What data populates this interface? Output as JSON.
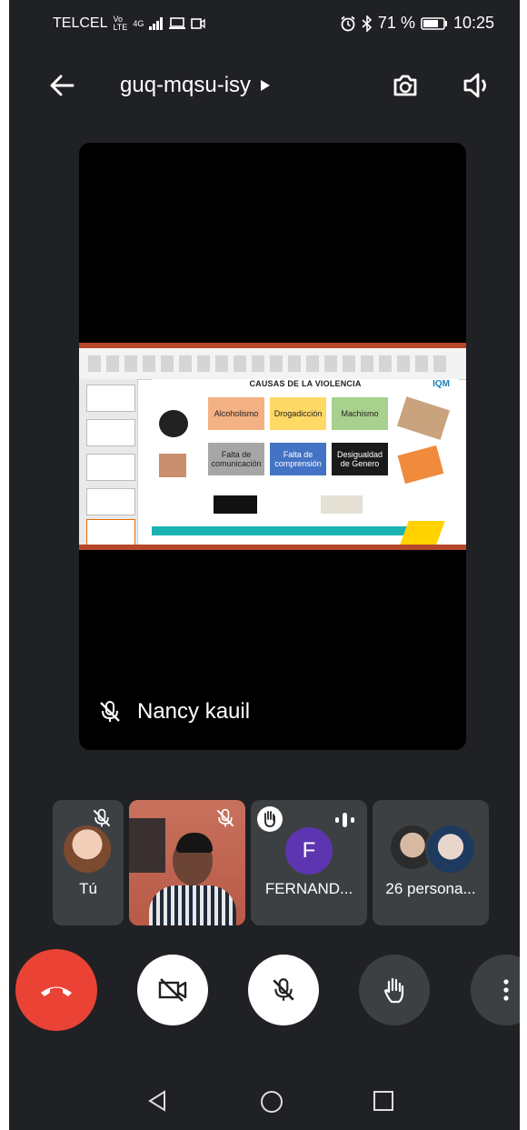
{
  "status_bar": {
    "carrier": "TELCEL",
    "volte": "Vo\nLTE",
    "network": "4G",
    "battery": "71 %",
    "time": "10:25"
  },
  "top_bar": {
    "meeting_code": "guq-mqsu-isy"
  },
  "main_video": {
    "speaker_name": "Nancy kauil",
    "slide": {
      "title": "CAUSAS DE LA VIOLENCIA",
      "logo_text": "IQM",
      "boxes": [
        {
          "label": "Alcoholismo",
          "color": "#f4b183"
        },
        {
          "label": "Drogadicción",
          "color": "#ffd966"
        },
        {
          "label": "Machismo",
          "color": "#a9d18e"
        },
        {
          "label": "Falta de comunicación",
          "color": "#a6a6a6"
        },
        {
          "label": "Falta de comprensión",
          "color": "#4472c4"
        },
        {
          "label": "Desigualdad de Genero",
          "color": "#1a1a1a"
        }
      ]
    }
  },
  "participants": [
    {
      "label": "Tú"
    },
    {
      "label": ""
    },
    {
      "label": "FERNAND...",
      "initial": "F",
      "avatar_color": "#5e35b1"
    },
    {
      "label": "26 persona..."
    }
  ],
  "colors": {
    "background": "#202124",
    "tile": "#3c4043",
    "end_call": "#ea4335"
  },
  "icons": [
    "back-arrow-icon",
    "play-triangle-icon",
    "switch-camera-icon",
    "speaker-icon",
    "mic-off-icon",
    "hand-raise-icon",
    "audio-activity-icon",
    "end-call-icon",
    "camera-off-icon",
    "more-options-icon",
    "nav-back-icon",
    "nav-home-icon",
    "nav-recents-icon"
  ]
}
